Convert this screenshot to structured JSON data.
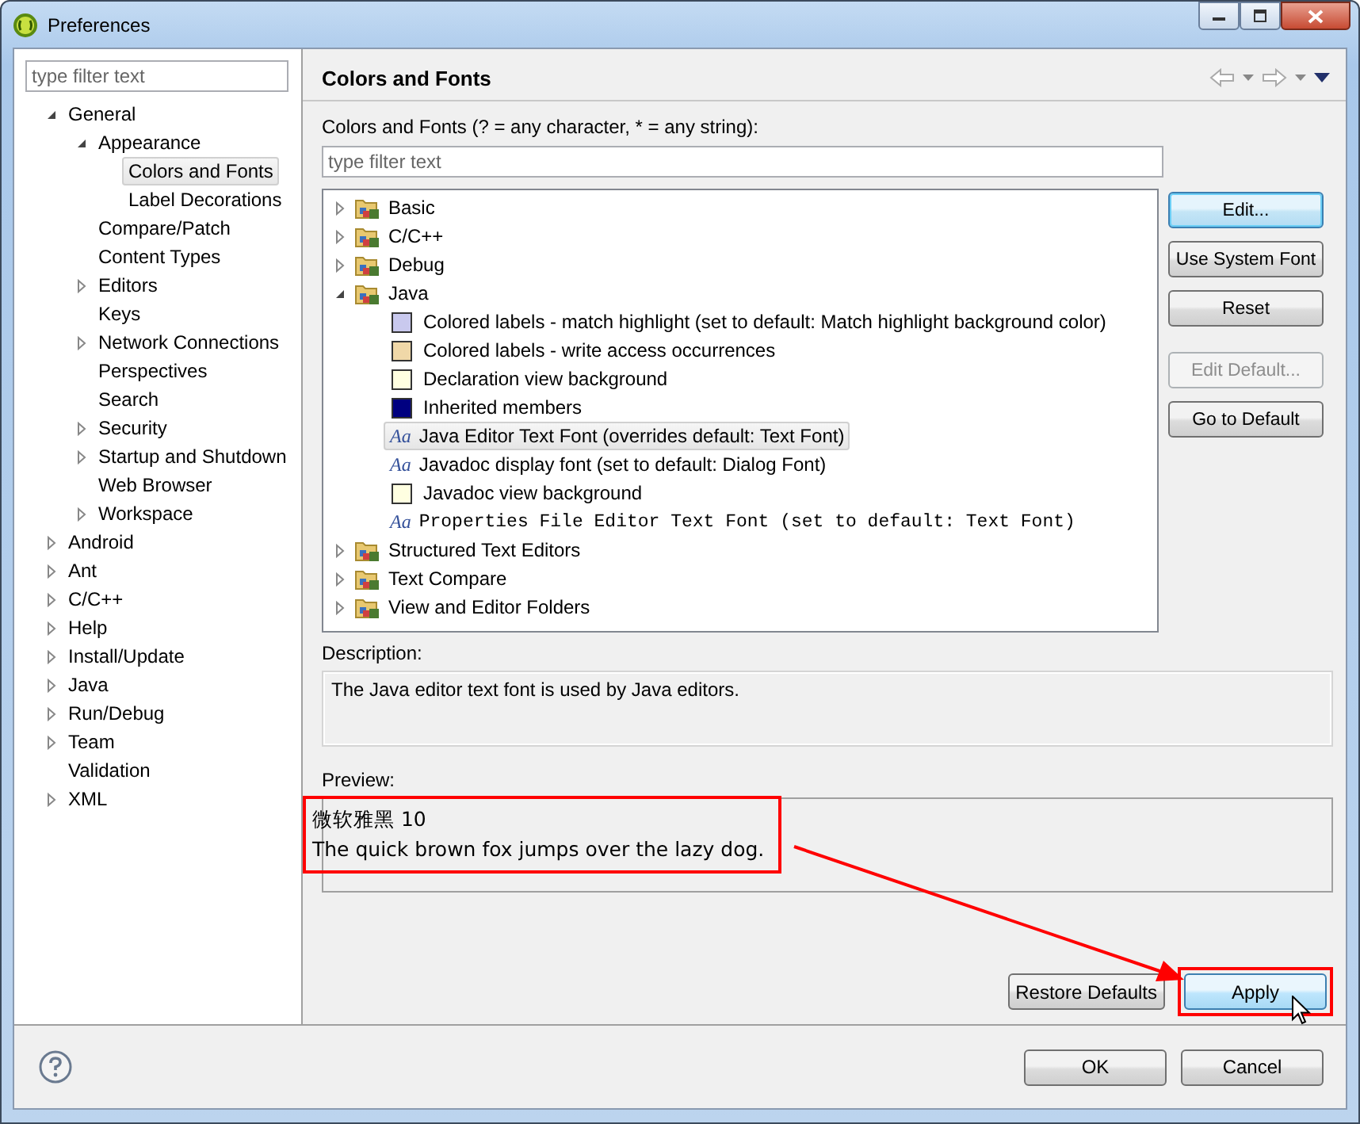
{
  "window": {
    "title": "Preferences"
  },
  "sidebar": {
    "filter": {
      "placeholder": "type filter text"
    },
    "tree": [
      {
        "label": "General",
        "expanded": true,
        "selected": false,
        "children": [
          {
            "label": "Appearance",
            "expanded": true,
            "selected": false,
            "children": [
              {
                "label": "Colors and Fonts",
                "selected": true
              },
              {
                "label": "Label Decorations",
                "selected": false
              }
            ]
          },
          {
            "label": "Compare/Patch",
            "selected": false
          },
          {
            "label": "Content Types",
            "selected": false
          },
          {
            "label": "Editors",
            "expanded": false,
            "selected": false
          },
          {
            "label": "Keys",
            "selected": false
          },
          {
            "label": "Network Connections",
            "expanded": false,
            "selected": false
          },
          {
            "label": "Perspectives",
            "selected": false
          },
          {
            "label": "Search",
            "selected": false
          },
          {
            "label": "Security",
            "expanded": false,
            "selected": false
          },
          {
            "label": "Startup and Shutdown",
            "expanded": false,
            "selected": false
          },
          {
            "label": "Web Browser",
            "selected": false
          },
          {
            "label": "Workspace",
            "expanded": false,
            "selected": false
          }
        ]
      },
      {
        "label": "Android",
        "expanded": false,
        "selected": false
      },
      {
        "label": "Ant",
        "expanded": false,
        "selected": false
      },
      {
        "label": "C/C++",
        "expanded": false,
        "selected": false
      },
      {
        "label": "Help",
        "expanded": false,
        "selected": false
      },
      {
        "label": "Install/Update",
        "expanded": false,
        "selected": false
      },
      {
        "label": "Java",
        "expanded": false,
        "selected": false
      },
      {
        "label": "Run/Debug",
        "expanded": false,
        "selected": false
      },
      {
        "label": "Team",
        "expanded": false,
        "selected": false
      },
      {
        "label": "Validation",
        "selected": false
      },
      {
        "label": "XML",
        "expanded": false,
        "selected": false
      }
    ]
  },
  "page": {
    "title": "Colors and Fonts",
    "filter_label": "Colors and Fonts (? = any character, * = any string):",
    "filter": {
      "placeholder": "type filter text"
    },
    "tree": [
      {
        "label": "Basic",
        "kind": "category",
        "expanded": false,
        "selected": false
      },
      {
        "label": "C/C++",
        "kind": "category",
        "expanded": false,
        "selected": false
      },
      {
        "label": "Debug",
        "kind": "category",
        "expanded": false,
        "selected": false
      },
      {
        "label": "Java",
        "kind": "category",
        "expanded": true,
        "selected": false,
        "children": [
          {
            "label": "Colored labels - match highlight (set to default: Match highlight background color)",
            "kind": "color",
            "color": "#c9c9ee",
            "selected": false
          },
          {
            "label": "Colored labels - write access occurrences",
            "kind": "color",
            "color": "#f0d8a8",
            "selected": false
          },
          {
            "label": "Declaration view background",
            "kind": "color",
            "color": "#ffffe1",
            "selected": false
          },
          {
            "label": "Inherited members",
            "kind": "color",
            "color": "#000080",
            "selected": false
          },
          {
            "label": "Java Editor Text Font (overrides default: Text Font)",
            "kind": "font",
            "icon": "Aa",
            "selected": true
          },
          {
            "label": "Javadoc display font (set to default: Dialog Font)",
            "kind": "font",
            "icon": "Aa",
            "selected": false
          },
          {
            "label": "Javadoc view background",
            "kind": "color",
            "color": "#ffffe1",
            "selected": false
          },
          {
            "label": "Properties File Editor Text Font (set to default: Text Font)",
            "kind": "mono_font",
            "icon": "Aa",
            "selected": false
          }
        ]
      },
      {
        "label": "Structured Text Editors",
        "kind": "category",
        "expanded": false,
        "selected": false
      },
      {
        "label": "Text Compare",
        "kind": "category",
        "expanded": false,
        "selected": false
      },
      {
        "label": "View and Editor Folders",
        "kind": "category",
        "expanded": false,
        "selected": false
      }
    ],
    "side_buttons": [
      {
        "label": "Edit...",
        "disabled": false,
        "focused": true
      },
      {
        "label": "Use System Font",
        "disabled": false,
        "focused": false
      },
      {
        "label": "Reset",
        "disabled": false,
        "focused": false
      },
      {
        "label": "Edit Default...",
        "disabled": true,
        "focused": false
      },
      {
        "label": "Go to Default",
        "disabled": false,
        "focused": false
      }
    ],
    "description_label": "Description:",
    "description": "The Java editor text font is used by Java editors.",
    "preview_label": "Preview:",
    "preview": {
      "lines": [
        "微软雅黑 10",
        "The quick brown fox jumps over the lazy dog."
      ],
      "highlighted": true
    },
    "buttons": [
      {
        "label": "Restore Defaults",
        "hovered": false,
        "highlighted": false
      },
      {
        "label": "Apply",
        "hovered": true,
        "highlighted": true
      }
    ]
  },
  "dialog_buttons": [
    {
      "label": "OK"
    },
    {
      "label": "Cancel"
    }
  ]
}
